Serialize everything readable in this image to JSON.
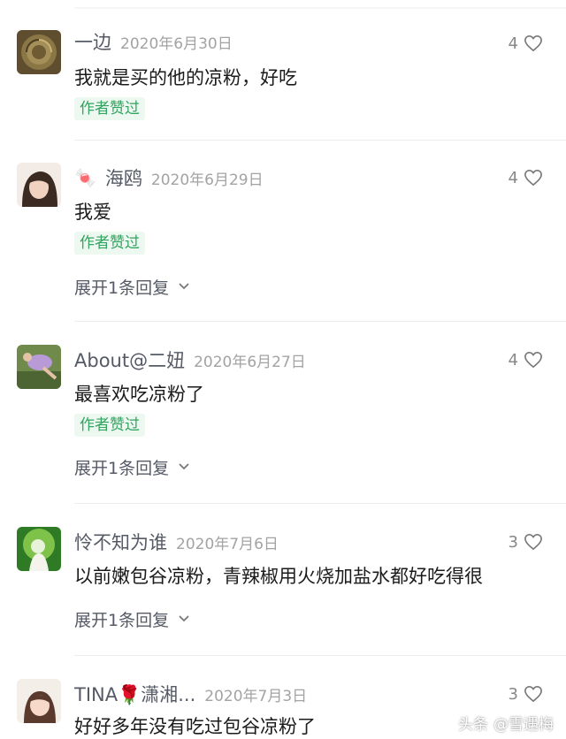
{
  "comments": [
    {
      "username": "一边",
      "emoji": "",
      "date": "2020年6月30日",
      "likes": "4",
      "text": "我就是买的他的凉粉，好吃",
      "badge": "作者赞过",
      "expand": "",
      "avatar_icon": "round-pattern-avatar"
    },
    {
      "username": "海鸥",
      "emoji": "🍬",
      "date": "2020年6月29日",
      "likes": "4",
      "text": "我爱",
      "badge": "作者赞过",
      "expand": "展开1条回复",
      "avatar_icon": "woman-portrait-avatar"
    },
    {
      "username": "About@二妞",
      "emoji": "",
      "date": "2020年6月27日",
      "likes": "4",
      "text": "最喜欢吃凉粉了",
      "badge": "作者赞过",
      "expand": "展开1条回复",
      "avatar_icon": "person-lying-avatar"
    },
    {
      "username": "怜不知为谁",
      "emoji": "",
      "date": "2020年7月6日",
      "likes": "3",
      "text": "以前嫩包谷凉粉，青辣椒用火烧加盐水都好吃得很",
      "badge": "",
      "expand": "展开1条回复",
      "avatar_icon": "green-scenery-avatar"
    },
    {
      "username": "TINA🌹潇湘...",
      "emoji": "",
      "date": "2020年7月3日",
      "likes": "3",
      "text": "好好多年没有吃过包谷凉粉了",
      "badge": "",
      "expand": "",
      "avatar_icon": "girl-portrait-avatar"
    }
  ],
  "watermark": {
    "app": "头条",
    "author": "@雪遇梅"
  },
  "colors": {
    "badge_bg": "#ecf8f0",
    "badge_text": "#33a45f",
    "username": "#555a66",
    "date": "#a3a3a3"
  }
}
